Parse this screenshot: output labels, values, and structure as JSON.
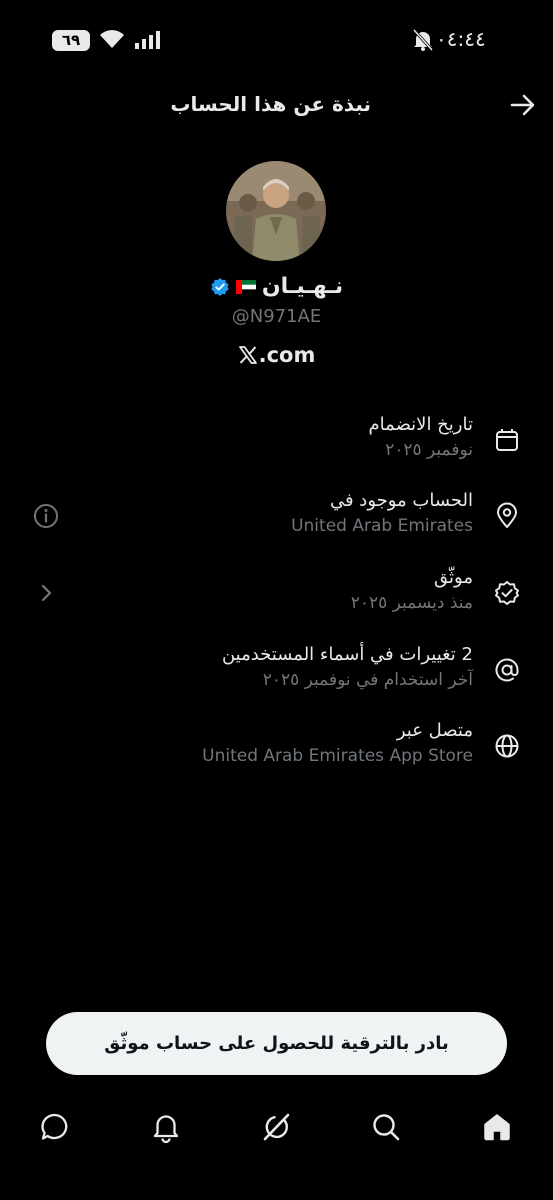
{
  "status_bar": {
    "time": "٠٤:٤٤",
    "battery": "٦٩"
  },
  "header": {
    "title": "نبذة عن هذا الحساب"
  },
  "profile": {
    "display_name": "نـهـيـان",
    "handle": "@N971AE",
    "link_text": ".com"
  },
  "info": [
    {
      "icon": "calendar-icon",
      "title": "تاريخ الانضمام",
      "subtitle": "نوفمبر ٢٠٢٥"
    },
    {
      "icon": "location-pin-icon",
      "title": "الحساب موجود في",
      "subtitle": "United Arab Emirates"
    },
    {
      "icon": "verified-badge-icon",
      "title": "موثّق",
      "subtitle": "منذ ديسمبر ٢٠٢٥"
    },
    {
      "icon": "at-sign-icon",
      "title": "2 تغييرات في أسماء المستخدمين",
      "subtitle": "آخر استخدام في نوفمبر ٢٠٢٥"
    },
    {
      "icon": "globe-icon",
      "title": "متصل عبر",
      "subtitle": "United Arab Emirates App Store"
    }
  ],
  "upgrade_button": {
    "label": "بادر بالترقية للحصول على حساب موثّق"
  },
  "colors": {
    "background": "#000000",
    "text_primary": "#e7e9ea",
    "text_secondary": "#71767b",
    "verified_blue": "#1d9bf0",
    "button_bg": "#eff3f4"
  }
}
